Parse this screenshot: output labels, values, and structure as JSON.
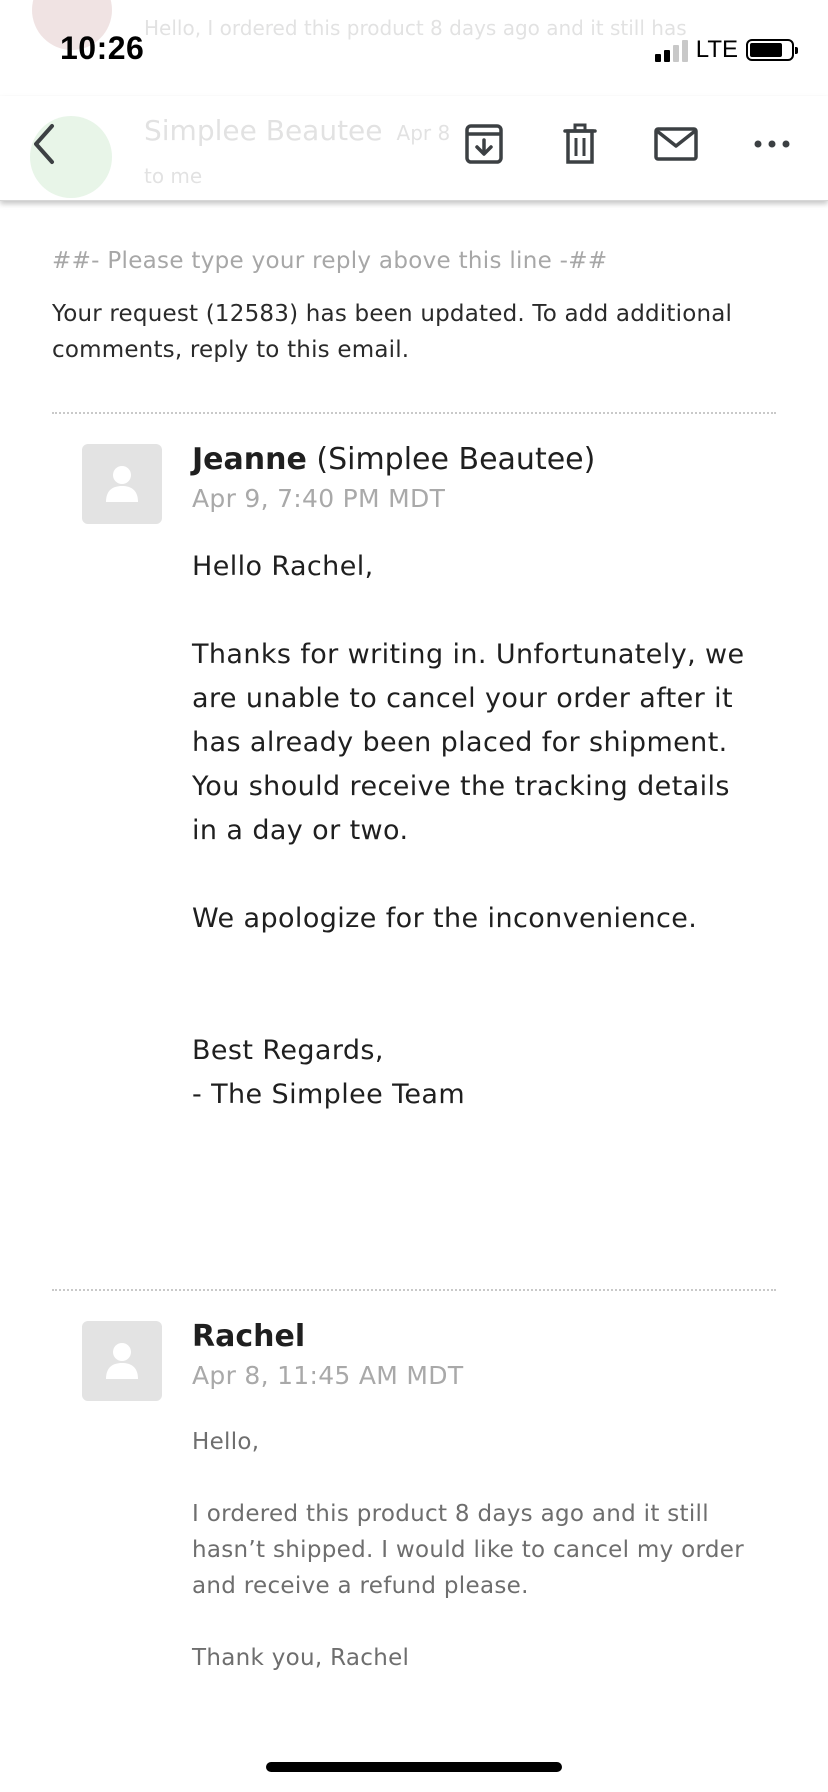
{
  "status_bar": {
    "time": "10:26",
    "network": "LTE",
    "signal_bars_filled": 2,
    "signal_bars_total": 4,
    "battery_level": 0.8
  },
  "background_preview": {
    "snippet": "Hello, I ordered this product 8 days ago and it still has",
    "sender": "Simplee Beautee",
    "date": "Apr 8",
    "to": "to me"
  },
  "toolbar": {
    "icons": [
      "chevron-left-icon",
      "archive-icon",
      "trash-icon",
      "mail-icon",
      "more-icon"
    ]
  },
  "email": {
    "reply_line": "##- Please type your reply above this line -##",
    "notice": "Your request (12583) has been updated. To add additional comments, reply to this email.",
    "messages": [
      {
        "author_name": "Jeanne",
        "author_org": "(Simplee Beautee)",
        "date": "Apr 9, 7:40 PM MDT",
        "greeting": "Hello Rachel,",
        "paragraph_1_lines": [
          "Thanks for writing in. Unfortunately, we",
          "are unable to cancel your order after it",
          "has already been placed for shipment.",
          "You should receive the tracking details",
          "in a day or two."
        ],
        "paragraph_2": "We apologize for the inconvenience.",
        "signoff": "Best Regards,",
        "signature": "- The Simplee Team"
      },
      {
        "author_name": "Rachel",
        "date": "Apr 8, 11:45 AM MDT",
        "greeting": "Hello,",
        "body_lines": [
          "I ordered this product 8 days ago and it still",
          "hasn’t shipped. I would like to cancel my order",
          "and receive a refund please."
        ],
        "closing": "Thank you, Rachel"
      }
    ]
  },
  "colors": {
    "muted_text": "#a9a9a9",
    "body_text": "#1f1f1f",
    "avatar_placeholder": "#e3e3e3"
  }
}
